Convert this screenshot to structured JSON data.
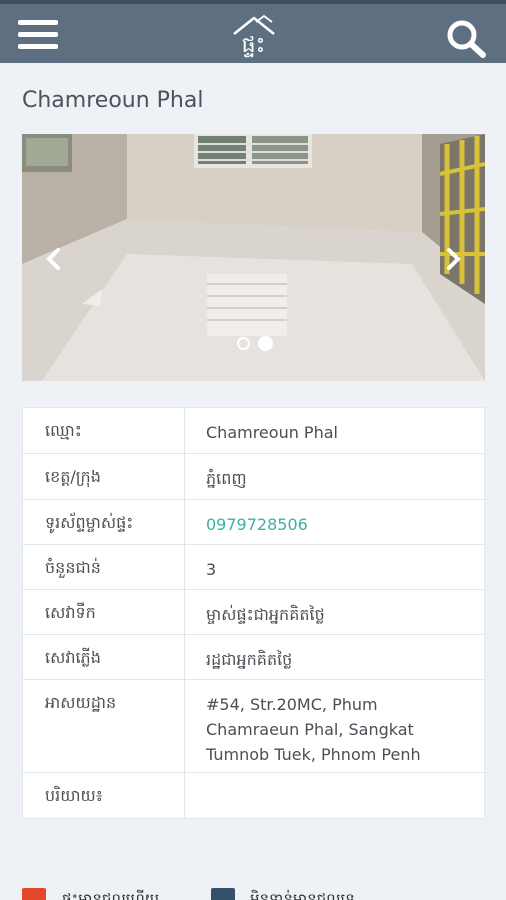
{
  "header": {
    "logo_text": "ផ្ទះ",
    "menu_icon": "hamburger-menu-icon",
    "search_icon": "search-icon"
  },
  "listing": {
    "title": "Chamreoun Phal",
    "gallery": {
      "image_count": 2,
      "active_index": 1,
      "prev_icon": "chevron-left-icon",
      "next_icon": "chevron-right-icon"
    }
  },
  "details": {
    "rows": [
      {
        "label": "ឈ្មោះ",
        "value": "Chamreoun Phal"
      },
      {
        "label": "ខេត្ត/ក្រុង",
        "value": "ភ្នំពេញ"
      },
      {
        "label": "ទូរស័ព្ទម្ចាស់ផ្ទះ",
        "value": "0979728506"
      },
      {
        "label": "ចំនួនជាន់",
        "value": "3"
      },
      {
        "label": "សេវាទឹក",
        "value": "ម្ចាស់ផ្ទះជាអ្នកគិតថ្លៃ"
      },
      {
        "label": "សេវាភ្លើង",
        "value": "រដ្ឋជាអ្នកគិតថ្លៃ"
      },
      {
        "label": "អាសយដ្ឋាន",
        "value": "#54, Str.20MC, Phum Chamraeun Phal, Sangkat Tumnob Tuek, Phnom Penh"
      },
      {
        "label": "បរិយាយ៖",
        "value": ""
      }
    ]
  },
  "footer": {
    "legend": [
      {
        "color": "#e2492b",
        "label": "ផ្ទះមានជួលហើយ"
      },
      {
        "color": "#35506b",
        "label": "មិនទាន់មានជួលទេ"
      }
    ]
  },
  "colors": {
    "topbar": "#5d6f80",
    "phone_link": "#3db0a3",
    "background": "#eef1f5"
  }
}
